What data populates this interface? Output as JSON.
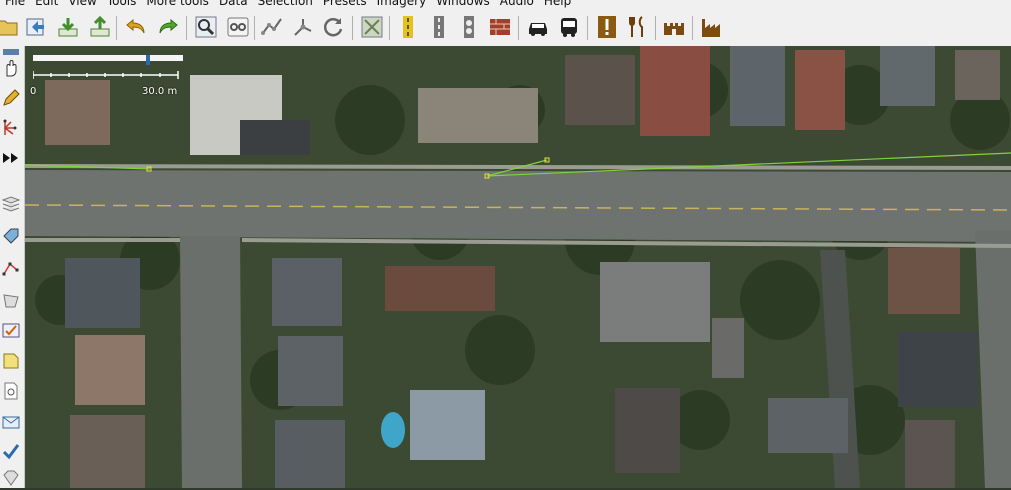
{
  "menu": {
    "items": [
      "File",
      "Edit",
      "View",
      "Tools",
      "More tools",
      "Data",
      "Selection",
      "Presets",
      "Imagery",
      "Windows",
      "Audio",
      "Help"
    ]
  },
  "toolbar": {
    "icons": [
      "open-icon",
      "download-icon",
      "upload-icon",
      "undo-icon",
      "redo-icon",
      "zoom-icon",
      "preferences-icon",
      "draw-icon",
      "combine-icon",
      "refresh-icon",
      "layers-icon",
      "road-icon",
      "road-marking-icon",
      "traffic-light-icon",
      "barrier-icon",
      "car-icon",
      "bus-icon",
      "warning-icon",
      "restaurant-icon",
      "castle-icon",
      "industrial-icon"
    ]
  },
  "scale_bar": {
    "zero_label": "0",
    "value_label": "30.0 m"
  },
  "colors": {
    "way": "#7fd43c",
    "node": "#e9e23a"
  }
}
